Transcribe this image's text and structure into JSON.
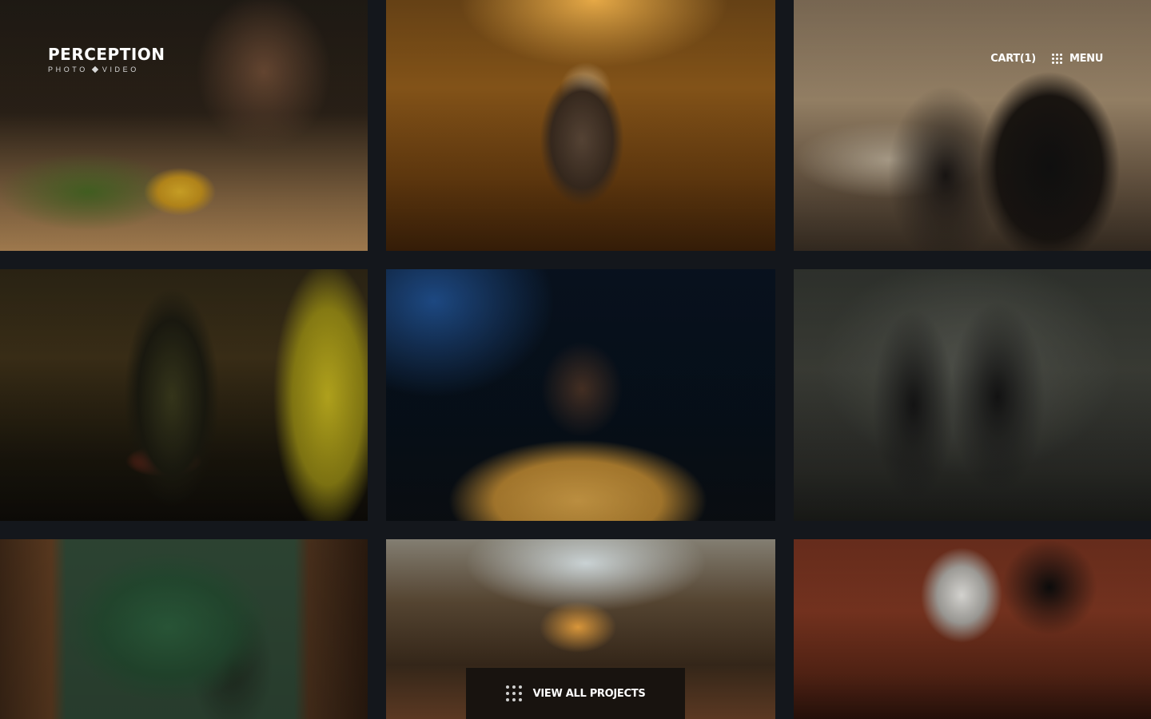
{
  "brand": {
    "name": "PERCEPTION",
    "sub_left": "PHOTO",
    "sub_right": "VIDEO"
  },
  "nav": {
    "cart_label": "CART(1)",
    "menu_label": "MENU",
    "menu_icon": "grid-dots-icon"
  },
  "gallery": {
    "items": [
      {
        "subject": "woman-eating-cafe-photo"
      },
      {
        "subject": "golden-retriever-sunset-photo"
      },
      {
        "subject": "couple-champagne-sofa-photo"
      },
      {
        "subject": "boxer-gym-photo"
      },
      {
        "subject": "man-michigan-sweater-photo"
      },
      {
        "subject": "fashion-duo-industrial-photo"
      },
      {
        "subject": "subway-passengers-photo"
      },
      {
        "subject": "junkyard-structure-photo"
      },
      {
        "subject": "studio-interview-setup-photo"
      }
    ]
  },
  "cta": {
    "view_all_label": "VIEW ALL PROJECTS",
    "icon": "grid-dots-icon"
  },
  "colors": {
    "page_background": "#14171c",
    "text": "#ffffff",
    "cta_background": "#18130f"
  }
}
